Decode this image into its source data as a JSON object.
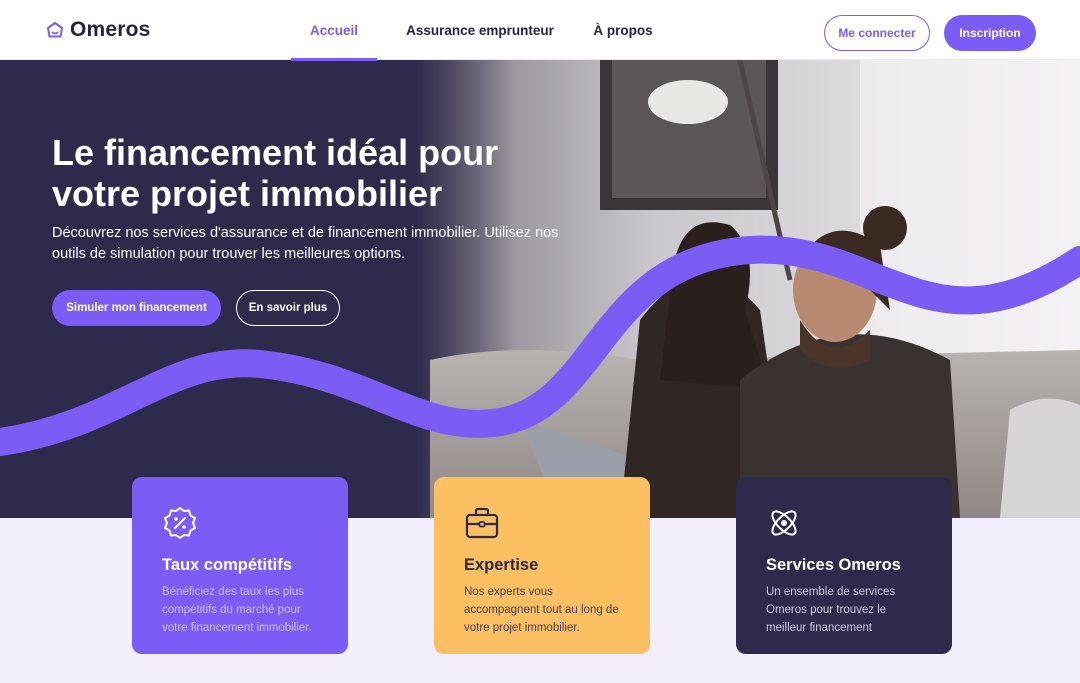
{
  "brand": {
    "name": "Omeros",
    "accent": "#7b5cf5",
    "dark": "#2e2a4c",
    "yellow": "#fcc062"
  },
  "nav": {
    "items": [
      {
        "label": "Accueil",
        "active": true
      },
      {
        "label": "Assurance emprunteur",
        "active": false
      },
      {
        "label": "À propos",
        "active": false
      }
    ]
  },
  "auth": {
    "login_label": "Me connecter",
    "signup_label": "Inscription"
  },
  "hero": {
    "title": "Le financement idéal pour votre projet immobilier",
    "subtitle": "Découvrez nos services d'assurance et de financement immobilier. Utilisez nos outils de simulation pour trouver les meilleures options.",
    "cta_primary": "Simuler mon financement",
    "cta_secondary": "En savoir plus"
  },
  "features": [
    {
      "icon": "percent-badge-icon",
      "title": "Taux compétitifs",
      "text": "Bénéficiez des taux les plus compétitifs du marché pour votre financement immobilier."
    },
    {
      "icon": "briefcase-icon",
      "title": "Expertise",
      "text": "Nos experts vous accompagnent tout au long de votre projet immobilier."
    },
    {
      "icon": "atom-icon",
      "title": "Services Omeros",
      "text": "Un ensemble de services Omeros pour trouvez le meilleur financement"
    }
  ]
}
